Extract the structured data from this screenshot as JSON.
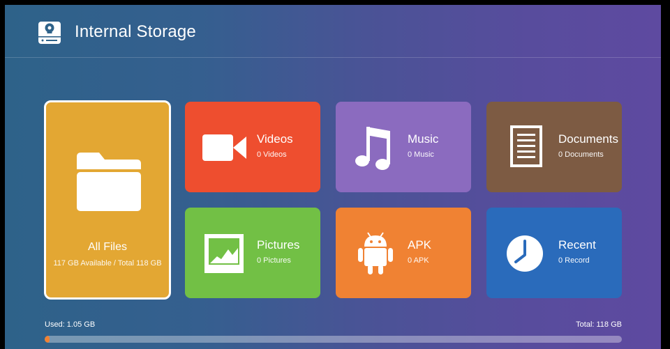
{
  "header": {
    "title": "Internal Storage",
    "icon": "hard-drive-icon"
  },
  "all_files": {
    "label": "All Files",
    "storage_text": "117 GB Available / Total 118 GB",
    "icon": "folder-icon",
    "color": "#e3a733"
  },
  "tiles": [
    {
      "name": "Videos",
      "count": "0 Videos",
      "icon": "video-camera-icon",
      "color": "#ee4e2f"
    },
    {
      "name": "Music",
      "count": "0 Music",
      "icon": "music-note-icon",
      "color": "#8b6bbf"
    },
    {
      "name": "Documents",
      "count": "0 Documents",
      "icon": "document-icon",
      "color": "#7d5b43"
    },
    {
      "name": "Pictures",
      "count": "0 Pictures",
      "icon": "picture-icon",
      "color": "#72c045"
    },
    {
      "name": "APK",
      "count": "0 APK",
      "icon": "android-icon",
      "color": "#f08233"
    },
    {
      "name": "Recent",
      "count": "0 Record",
      "icon": "clock-icon",
      "color": "#2a6bbb"
    }
  ],
  "storage": {
    "used_label": "Used: 1.05 GB",
    "total_label": "Total: 118 GB",
    "used_fraction": 0.0089
  }
}
